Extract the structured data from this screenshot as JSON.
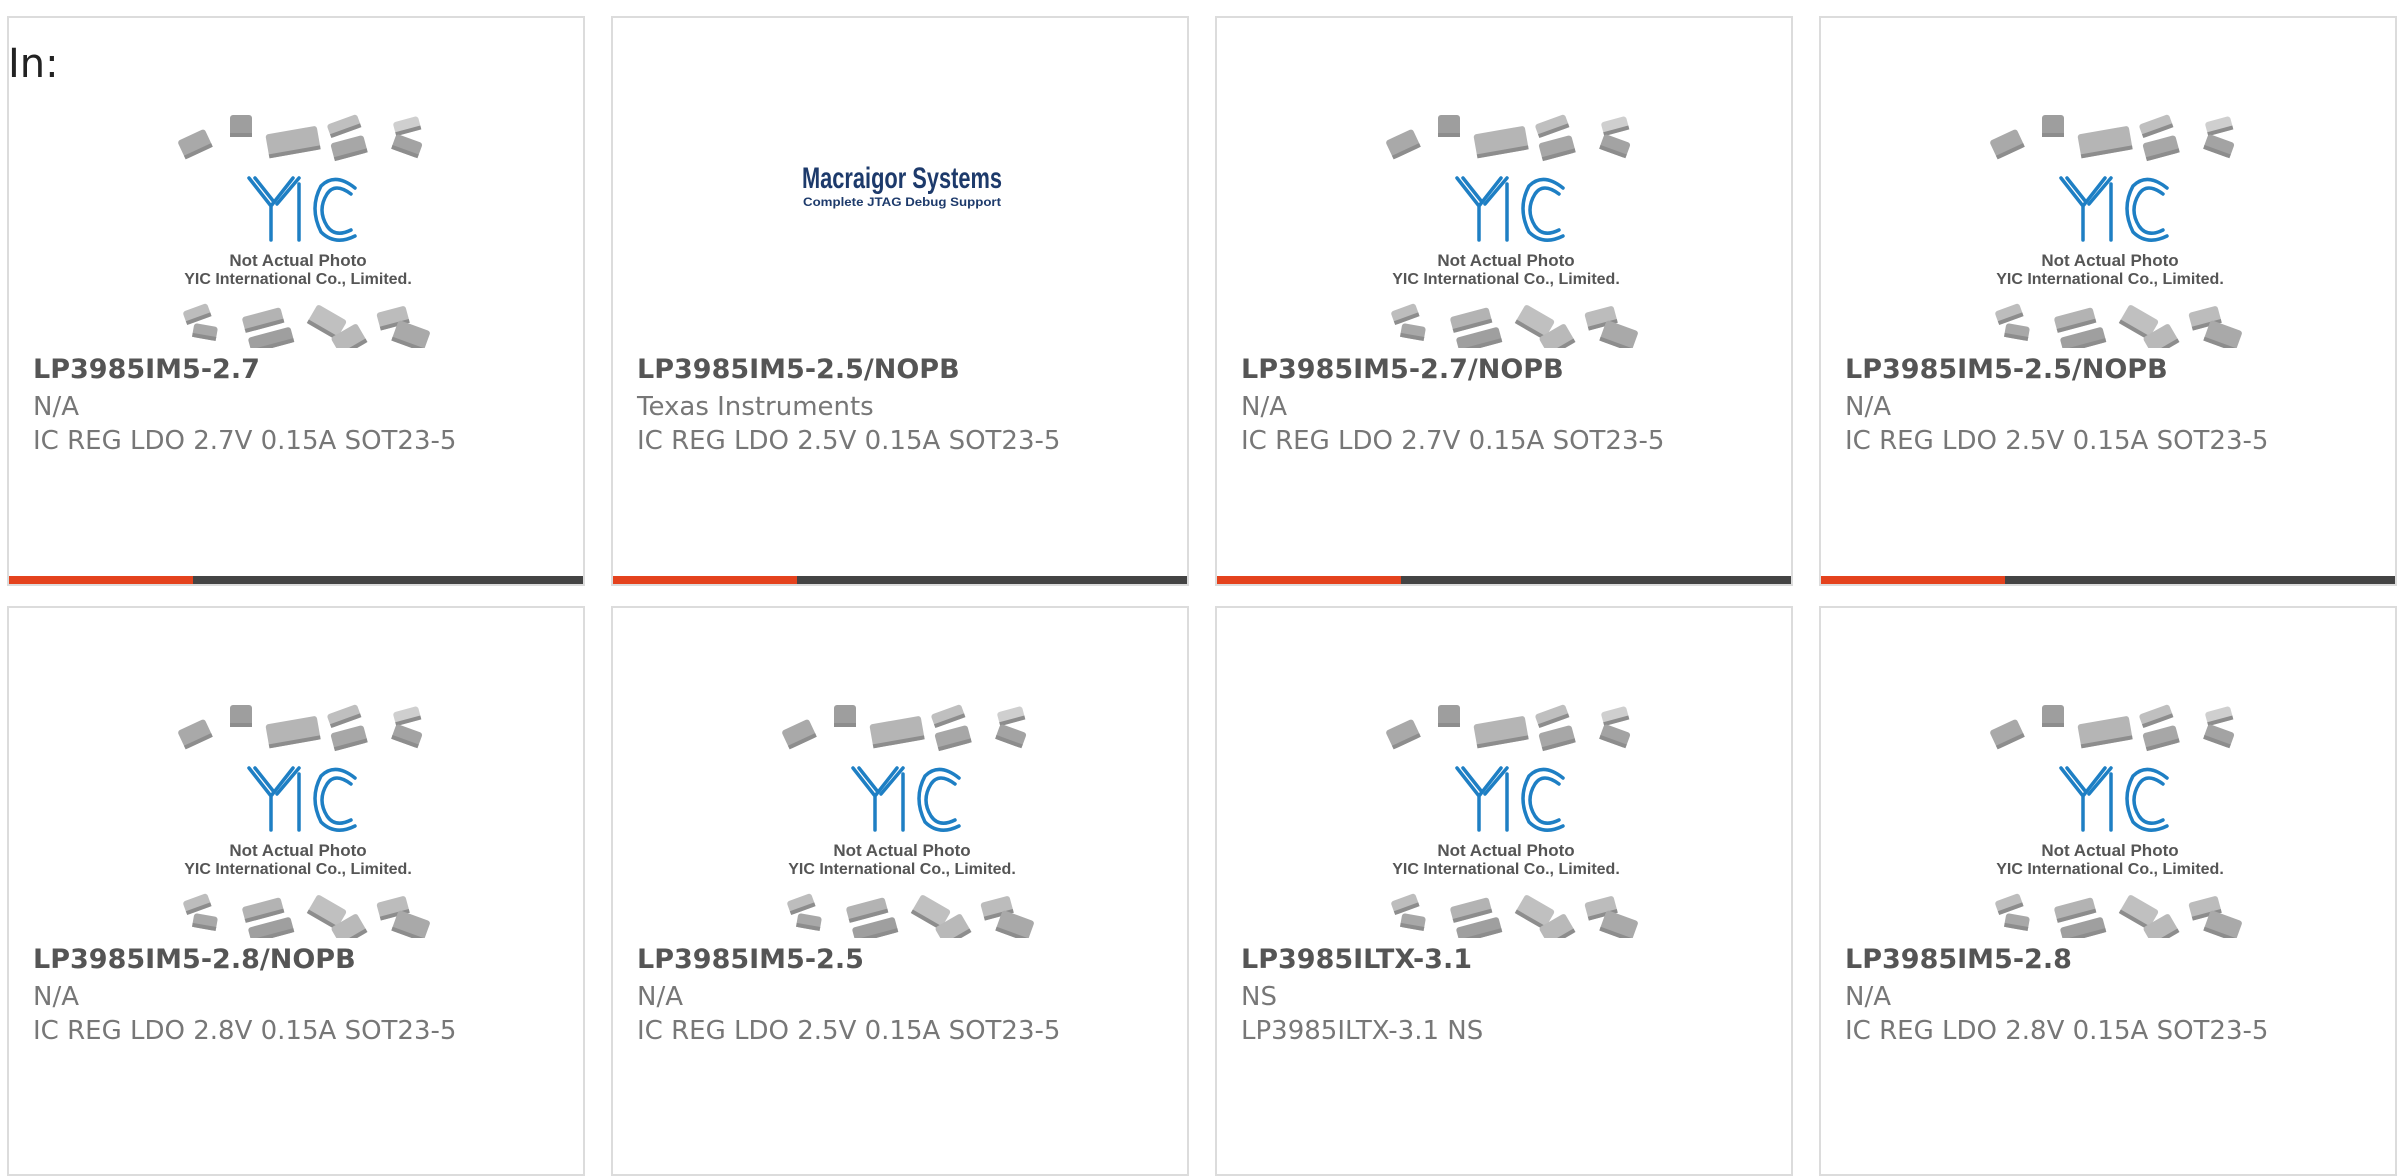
{
  "filter": {
    "label": "In:"
  },
  "placeholder_image": {
    "caption_line1": "Not Actual Photo",
    "caption_line2": "YIC International Co., Limited.",
    "logo_text": "YIC"
  },
  "brand_logo": {
    "title": "Macraigor Systems",
    "tagline": "Complete JTAG Debug Support"
  },
  "colors": {
    "accent": "#e4421d",
    "bar": "#444444",
    "border": "#dcdcdc",
    "logo_blue": "#1e7fc4"
  },
  "products": [
    {
      "part": "LP3985IM5-2.7",
      "manufacturer": "N/A",
      "description": "IC REG LDO 2.7V 0.15A SOT23-5",
      "image": "yic-placeholder",
      "progress": 0.32
    },
    {
      "part": "LP3985IM5-2.5/NOPB",
      "manufacturer": "Texas Instruments",
      "description": "IC REG LDO 2.5V 0.15A SOT23-5",
      "image": "macraigor-logo",
      "progress": 0.32
    },
    {
      "part": "LP3985IM5-2.7/NOPB",
      "manufacturer": "N/A",
      "description": "IC REG LDO 2.7V 0.15A SOT23-5",
      "image": "yic-placeholder",
      "progress": 0.32
    },
    {
      "part": "LP3985IM5-2.5/NOPB",
      "manufacturer": "N/A",
      "description": "IC REG LDO 2.5V 0.15A SOT23-5",
      "image": "yic-placeholder",
      "progress": 0.32
    },
    {
      "part": "LP3985IM5-2.8/NOPB",
      "manufacturer": "N/A",
      "description": "IC REG LDO 2.8V 0.15A SOT23-5",
      "image": "yic-placeholder"
    },
    {
      "part": "LP3985IM5-2.5",
      "manufacturer": "N/A",
      "description": "IC REG LDO 2.5V 0.15A SOT23-5",
      "image": "yic-placeholder"
    },
    {
      "part": "LP3985ILTX-3.1",
      "manufacturer": "NS",
      "description": "LP3985ILTX-3.1 NS",
      "image": "yic-placeholder"
    },
    {
      "part": "LP3985IM5-2.8",
      "manufacturer": "N/A",
      "description": "IC REG LDO 2.8V 0.15A SOT23-5",
      "image": "yic-placeholder"
    }
  ]
}
